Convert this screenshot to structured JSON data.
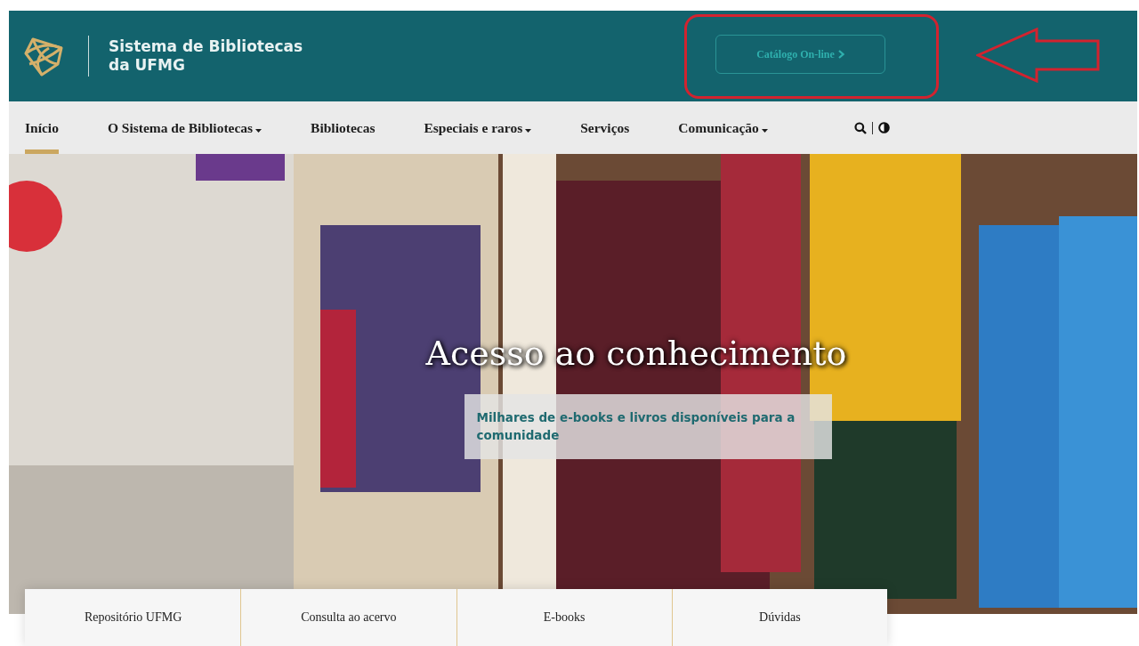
{
  "header": {
    "title_lines": [
      "Sistema de Bibliotecas",
      "da UFMG"
    ],
    "catalog_button": {
      "label": "Catálogo On-line"
    }
  },
  "nav": {
    "items": [
      {
        "label": "Início",
        "dropdown": false,
        "selected": true
      },
      {
        "label": "O Sistema de Bibliotecas",
        "dropdown": true,
        "selected": false
      },
      {
        "label": "Bibliotecas",
        "dropdown": false,
        "selected": false
      },
      {
        "label": "Especiais e raros",
        "dropdown": true,
        "selected": false
      },
      {
        "label": "Serviços",
        "dropdown": false,
        "selected": false
      },
      {
        "label": "Comunicação",
        "dropdown": true,
        "selected": false
      }
    ]
  },
  "hero": {
    "kind": "picture",
    "title": "Acesso ao conhecimento",
    "subtitle": "Milhares de e-books e livros disponíveis para a comunidade"
  },
  "quick_links": [
    "Repositório UFMG",
    "Consulta ao acervo",
    "E-books",
    "Dúvidas"
  ],
  "annotations": [
    {
      "kind": "highlight-box"
    },
    {
      "kind": "arrow"
    }
  ]
}
